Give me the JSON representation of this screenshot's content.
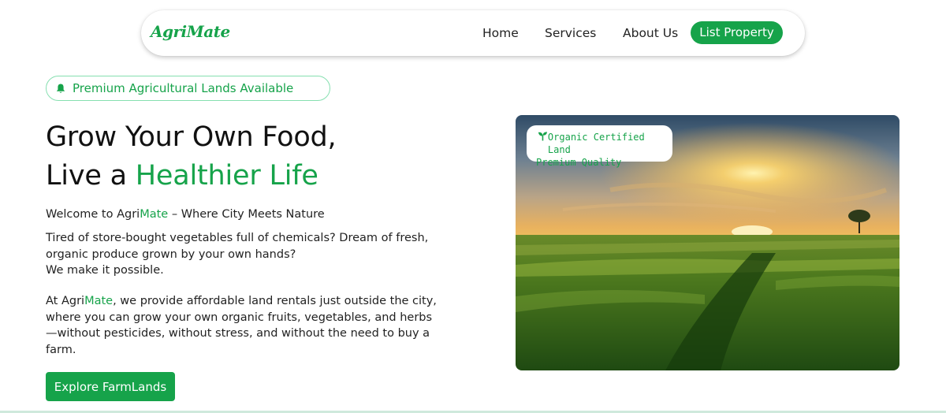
{
  "nav": {
    "logo": "AgriMate",
    "links": [
      {
        "label": "Home"
      },
      {
        "label": "Services"
      },
      {
        "label": "About Us"
      }
    ],
    "cta_label": "List Property"
  },
  "badge": {
    "icon": "bell-icon",
    "text": "Premium Agricultural Lands Available"
  },
  "hero": {
    "title_line1": "Grow Your Own Food,",
    "title_line2_prefix": "Live a ",
    "title_line2_highlight": "Healthier Life",
    "welcome_prefix": "Welcome to Agri",
    "welcome_highlight": "Mate",
    "welcome_suffix": " – Where City Meets Nature",
    "paragraph1_a": "Tired of store-bought vegetables full of chemicals? Dream of fresh, organic produce grown by your own hands?",
    "paragraph1_b": "We make it possible.",
    "paragraph2_prefix": "At Agri",
    "paragraph2_highlight": "Mate",
    "paragraph2_suffix": ", we provide affordable land rentals just outside the city, where you can grow your own organic fruits, vegetables, and herbs—without pesticides, without stress, and without the need to buy a farm.",
    "cta_label": "Explore FarmLands"
  },
  "image_card": {
    "icon": "sprout-icon",
    "line1": "Organic Certified Land",
    "line2": "Premium Quality"
  },
  "colors": {
    "brand_green": "#16a34a",
    "badge_border": "#86dfb0"
  }
}
